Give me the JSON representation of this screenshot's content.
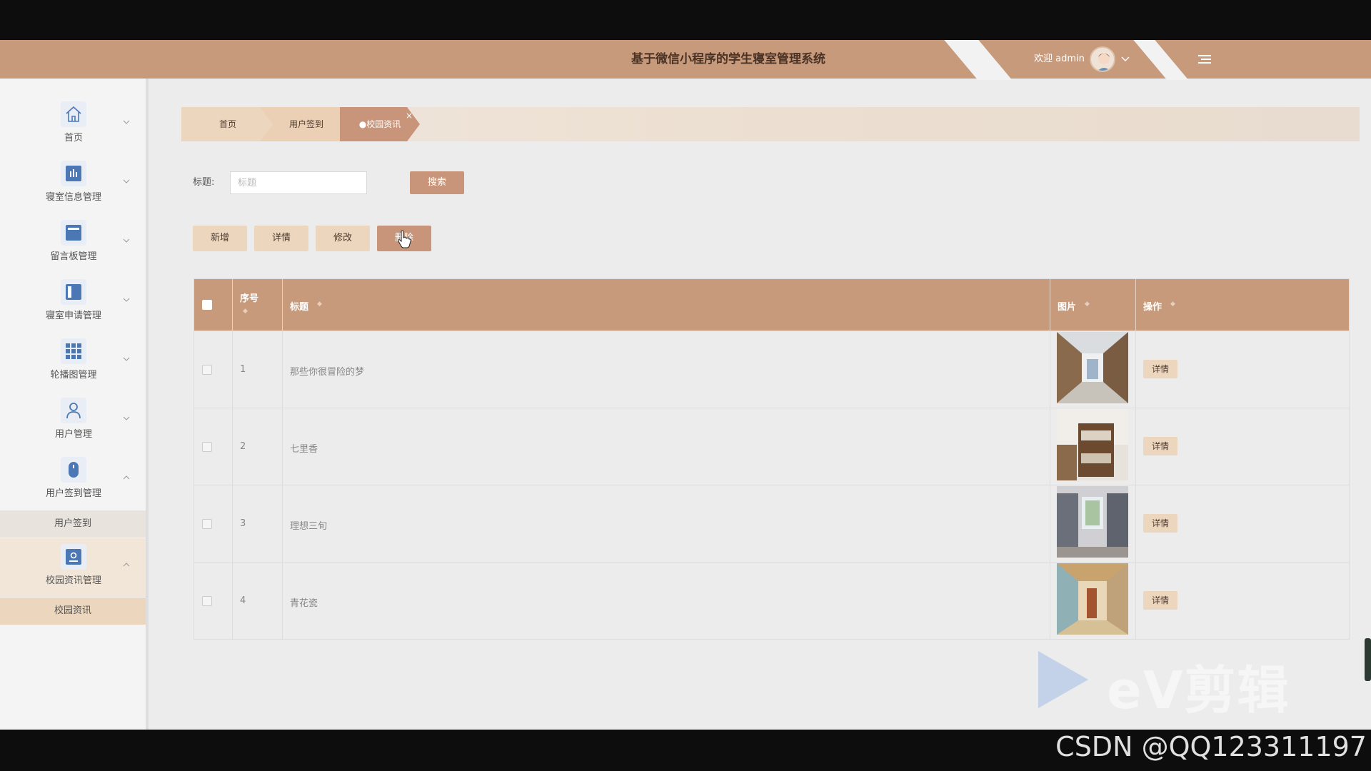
{
  "header": {
    "title": "基于微信小程序的学生寝室管理系统",
    "welcome": "欢迎 admin"
  },
  "sidebar": {
    "items": [
      {
        "label": "首页",
        "icon": "home-icon"
      },
      {
        "label": "寝室信息管理",
        "icon": "chart-icon"
      },
      {
        "label": "留言板管理",
        "icon": "board-icon"
      },
      {
        "label": "寝室申请管理",
        "icon": "panel-icon"
      },
      {
        "label": "轮播图管理",
        "icon": "grid-icon"
      },
      {
        "label": "用户管理",
        "icon": "user-icon"
      },
      {
        "label": "用户签到管理",
        "icon": "mouse-icon"
      },
      {
        "label": "校园资讯管理",
        "icon": "badge-icon"
      }
    ],
    "sub_sign": "用户签到",
    "sub_news": "校园资讯"
  },
  "tabs": [
    {
      "label": "首页"
    },
    {
      "label": "用户签到",
      "close": "×"
    },
    {
      "label": "●校园资讯",
      "close": "×"
    }
  ],
  "search": {
    "label": "标题:",
    "placeholder": "标题",
    "button": "搜索"
  },
  "actions": {
    "add": "新增",
    "detail": "详情",
    "edit": "修改",
    "delete": "删除"
  },
  "table": {
    "columns": [
      "序号",
      "标题",
      "图片",
      "操作"
    ],
    "rows": [
      {
        "index": "1",
        "title": "那些你很冒险的梦",
        "op": "详情"
      },
      {
        "index": "2",
        "title": "七里香",
        "op": "详情"
      },
      {
        "index": "3",
        "title": "理想三旬",
        "op": "详情"
      },
      {
        "index": "4",
        "title": "青花瓷",
        "op": "详情"
      }
    ]
  },
  "watermark": "eV剪辑",
  "footer": "CSDN @QQ123311197",
  "colors": {
    "accent": "#c79a7b",
    "button_light": "#ecd6bd",
    "button_dark": "#c9957a"
  }
}
